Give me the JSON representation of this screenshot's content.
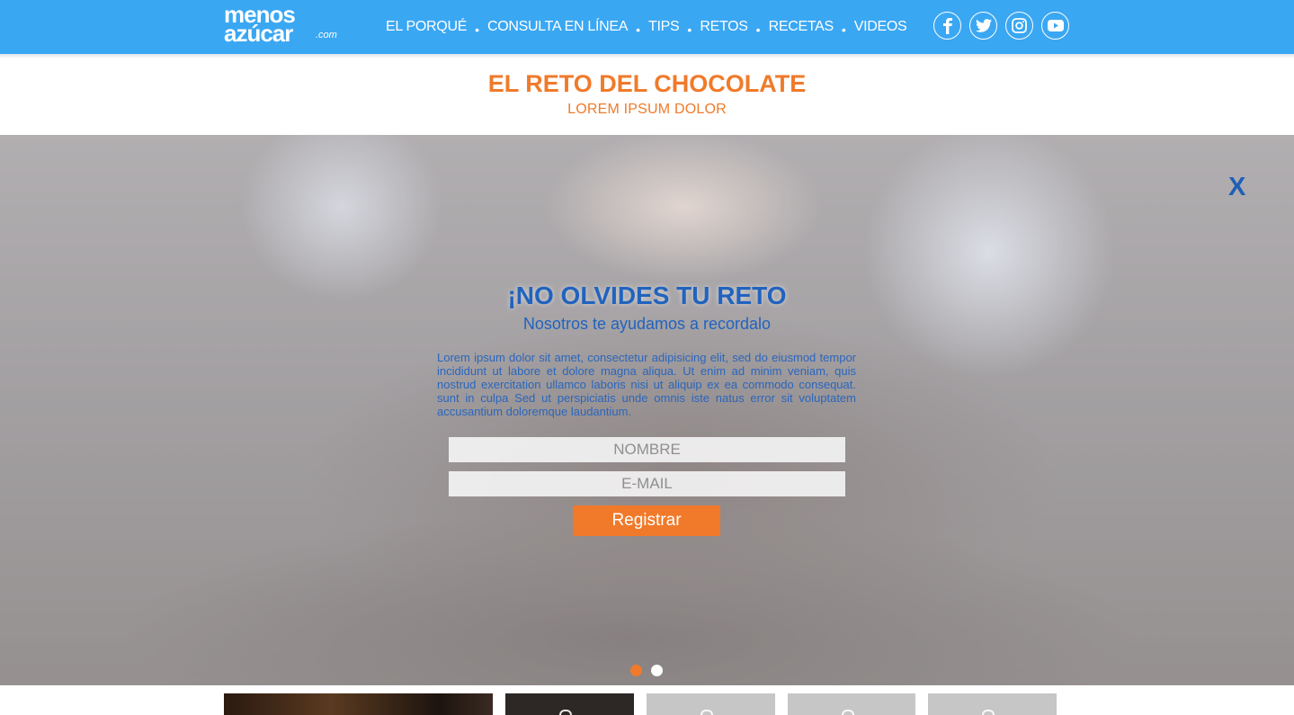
{
  "header": {
    "logo": {
      "line1": "menos",
      "line2": "azúcar",
      "suffix": ".com"
    },
    "nav": [
      {
        "label": "EL PORQUÉ"
      },
      {
        "label": "CONSULTA EN LÍNEA"
      },
      {
        "label": "TIPS"
      },
      {
        "label": "RETOS"
      },
      {
        "label": "RECETAS"
      },
      {
        "label": "VIDEOS"
      }
    ],
    "social": [
      "facebook-icon",
      "twitter-icon",
      "instagram-icon",
      "youtube-icon"
    ]
  },
  "page": {
    "title": "EL RETO DEL CHOCOLATE",
    "subtitle": "LOREM IPSUM DOLOR"
  },
  "modal": {
    "close_label": "X",
    "title": "¡NO OLVIDES TU RETO",
    "subtitle": "Nosotros te ayudamos a recordalo",
    "body": "Lorem ipsum dolor sit amet, consectetur adipisicing elit, sed do eiusmod tempor incididunt ut labore et dolore magna aliqua. Ut enim ad minim veniam, quis nostrud exercitation ullamco laboris nisi ut aliquip ex ea commodo consequat. sunt in culpa Sed ut perspiciatis unde omnis iste natus error sit voluptatem accusantium doloremque laudantium.",
    "name_placeholder": "NOMBRE",
    "email_placeholder": "E-MAIL",
    "submit_label": "Registrar"
  },
  "slider": {
    "active_index": 0,
    "count": 2
  },
  "colors": {
    "header_bg": "#3aa7f3",
    "accent_orange": "#f07a2a",
    "modal_blue": "#2163be",
    "close_blue": "#1f5fb8"
  }
}
